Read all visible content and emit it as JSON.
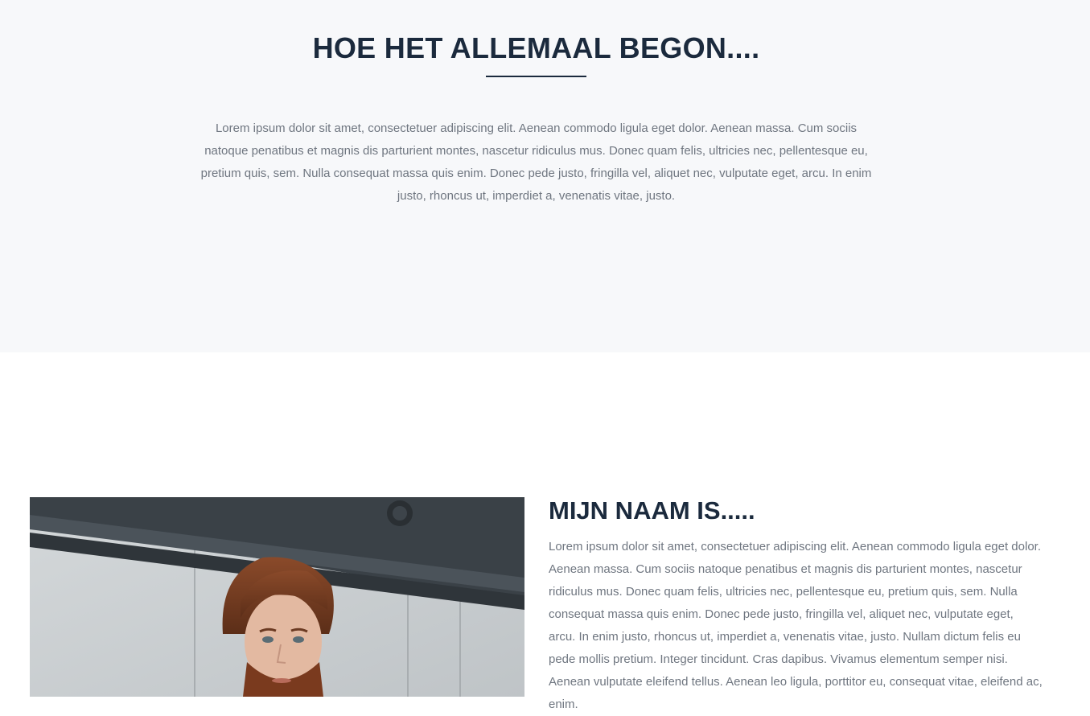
{
  "intro": {
    "title": "HOE HET ALLEMAAL BEGON....",
    "text": "Lorem ipsum dolor sit amet, consectetuer adipiscing elit. Aenean commodo ligula eget dolor. Aenean massa. Cum sociis natoque penatibus et magnis dis parturient montes, nascetur ridiculus mus. Donec quam felis, ultricies nec, pellentesque eu, pretium quis, sem. Nulla consequat massa quis enim. Donec pede justo, fringilla vel, aliquet nec, vulputate eget, arcu. In enim justo, rhoncus ut, imperdiet a, venenatis vitae, justo."
  },
  "about": {
    "title": "MIJN NAAM IS.....",
    "text": "Lorem ipsum dolor sit amet, consectetuer adipiscing elit. Aenean commodo ligula eget dolor. Aenean massa. Cum sociis natoque penatibus et magnis dis parturient montes, nascetur ridiculus mus. Donec quam felis, ultricies nec, pellentesque eu, pretium quis, sem. Nulla consequat massa quis enim. Donec pede justo, fringilla vel, aliquet nec, vulputate eget, arcu. In enim justo, rhoncus ut, imperdiet a, venenatis vitae, justo. Nullam dictum felis eu pede mollis pretium. Integer tincidunt. Cras dapibus. Vivamus elementum semper nisi. Aenean vulputate eleifend tellus. Aenean leo ligula, porttitor eu, consequat vitae, eleifend ac, enim."
  },
  "colors": {
    "heading": "#1b2a3d",
    "body_text": "#6f7680",
    "intro_background": "#f7f8fa"
  },
  "icons": {
    "portrait": "portrait-photo"
  }
}
